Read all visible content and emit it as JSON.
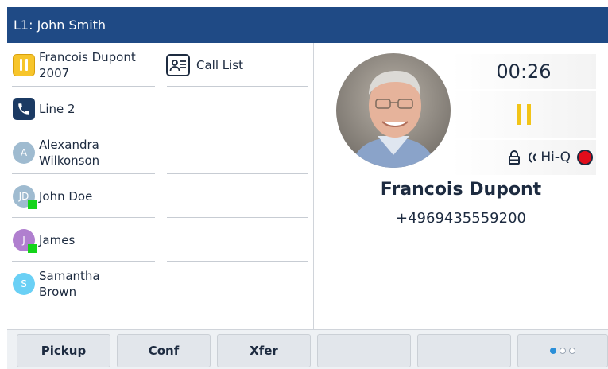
{
  "titlebar": {
    "text": "L1: John Smith"
  },
  "line_keys": [
    {
      "label_line1": "Francois Dupont",
      "label_line2": "2007",
      "icon": "hold-icon",
      "icon_color": "#f7c52b"
    },
    {
      "label_line1": "Line 2",
      "label_line2": "",
      "icon": "phone-icon",
      "icon_color": "#1b3a63"
    },
    {
      "label_line1": "Alexandra",
      "label_line2": "Wilkonson",
      "icon": "avatar",
      "initials": "A",
      "avatar_color": "#9fbbd0",
      "presence": false
    },
    {
      "label_line1": "John Doe",
      "label_line2": "",
      "icon": "avatar",
      "initials": "JD",
      "avatar_color": "#9fbbd0",
      "presence": true,
      "presence_color": "#14d41a"
    },
    {
      "label_line1": "James",
      "label_line2": "",
      "icon": "avatar",
      "initials": "J",
      "avatar_color": "#b07fcf",
      "presence": true,
      "presence_color": "#14d41a"
    },
    {
      "label_line1": "Samantha",
      "label_line2": "Brown",
      "icon": "avatar",
      "initials": "S",
      "avatar_color": "#6ad0f5",
      "presence": false
    }
  ],
  "call_list": {
    "label": "Call List",
    "icon": "call-list-icon"
  },
  "call": {
    "timer": "00:26",
    "status_icons": [
      "lock-icon",
      "hd-audio-icon",
      "record-icon"
    ],
    "hiq_label": "Hi-Q",
    "caller_name": "Francois Dupont",
    "caller_number": "+4969435559200",
    "photo": "caller-photo"
  },
  "softkeys": [
    {
      "label": "Pickup"
    },
    {
      "label": "Conf"
    },
    {
      "label": "Xfer"
    },
    {
      "label": ""
    },
    {
      "label": ""
    }
  ],
  "page_indicator": {
    "pages": 3,
    "current": 1
  },
  "colors": {
    "title_bar": "#1f4a85",
    "hold": "#f2c418",
    "record": "#e00d1b",
    "text": "#1d2b40",
    "page_dot_active": "#2a8fd8"
  }
}
